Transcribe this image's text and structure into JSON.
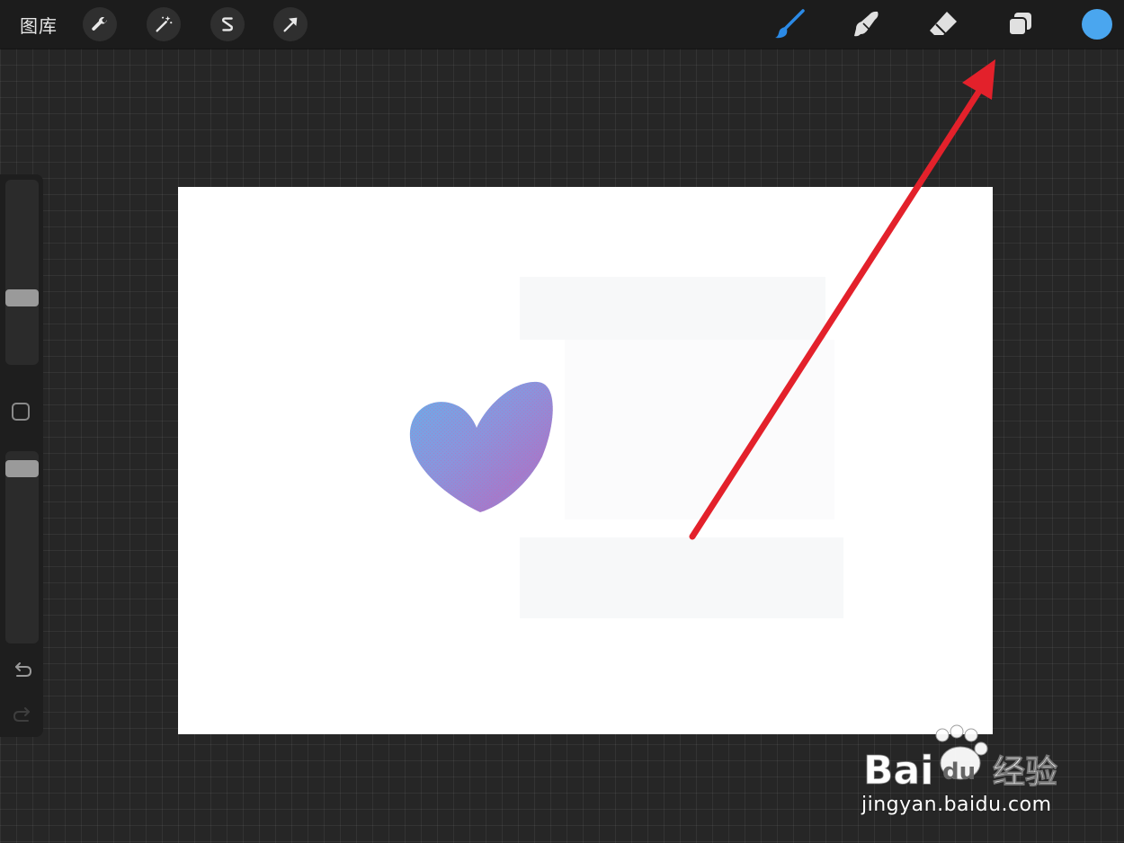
{
  "toolbar": {
    "gallery_label": "图库",
    "left_tools": [
      {
        "name": "actions",
        "icon": "wrench-icon"
      },
      {
        "name": "adjustments",
        "icon": "magic-wand-icon"
      },
      {
        "name": "selection",
        "icon": "selection-s-icon"
      },
      {
        "name": "transform",
        "icon": "arrow-cursor-icon"
      }
    ],
    "right_tools": [
      {
        "name": "brush",
        "icon": "brush-icon",
        "active": true
      },
      {
        "name": "smudge",
        "icon": "smudge-icon",
        "active": false
      },
      {
        "name": "eraser",
        "icon": "eraser-icon",
        "active": false
      },
      {
        "name": "layers",
        "icon": "layers-icon",
        "active": false
      }
    ],
    "color": "#4aa6ef"
  },
  "sidebar": {
    "brush_size_level": 0.35,
    "opacity_level": 0.97,
    "undo_icon": "undo-icon",
    "redo_icon": "redo-icon"
  },
  "canvas": {
    "background": "#ffffff",
    "shape": "heart",
    "shape_colors": [
      "#6aa8e4",
      "#b46fc0"
    ]
  },
  "annotation": {
    "color": "#e3212b",
    "target": "layers-icon"
  },
  "watermark": {
    "brand": "Bai经验",
    "url": "jingyan.baidu.com"
  }
}
